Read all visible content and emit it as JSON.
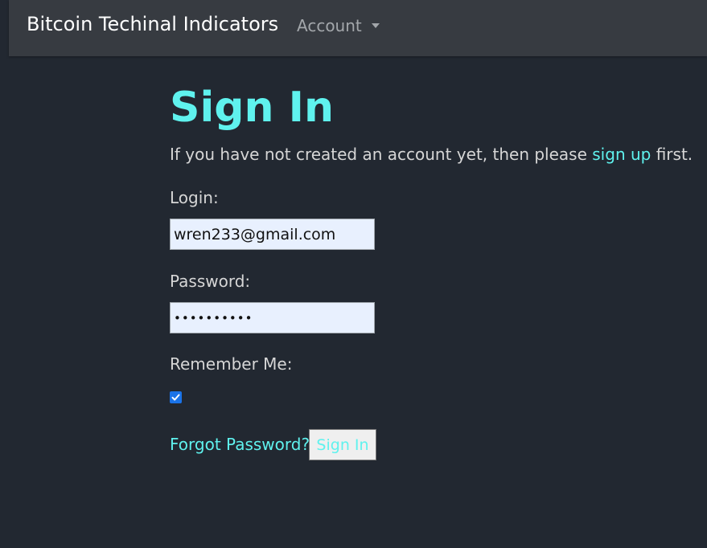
{
  "navbar": {
    "brand": "Bitcoin Techinal Indicators",
    "account_menu": "Account"
  },
  "main": {
    "title": "Sign In",
    "intro_before": "If you have not created an account yet, then please ",
    "signup_link": "sign up",
    "intro_after": " first.",
    "login_label": "Login:",
    "login_value": "wren233@gmail.com",
    "password_label": "Password:",
    "password_value": "••••••••••",
    "remember_label": "Remember Me:",
    "remember_checked": true,
    "forgot_link": "Forgot Password?",
    "signin_button": "Sign In"
  },
  "colors": {
    "background": "#222831",
    "navbar": "#373b41",
    "accent": "#5ff2ee",
    "text": "#d6d6d6",
    "input_background": "#e8f0fe",
    "checkbox": "#1a73e8"
  }
}
